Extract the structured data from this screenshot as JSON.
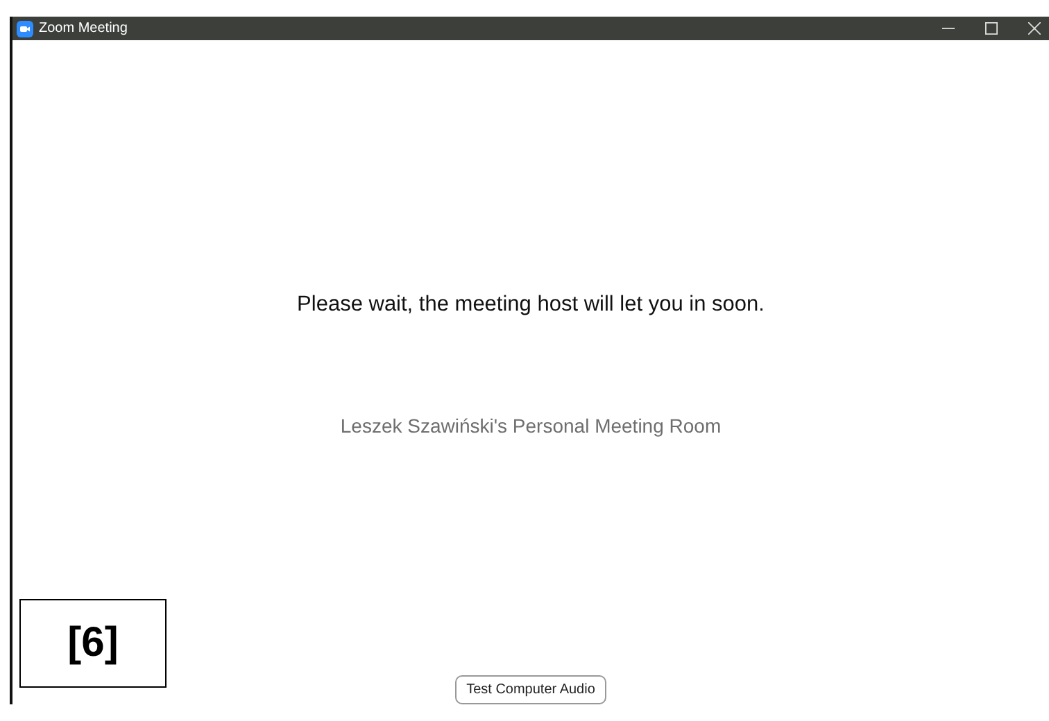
{
  "window": {
    "title": "Zoom Meeting"
  },
  "message": "Please wait, the meeting host will let you in soon.",
  "room_name": "Leszek Szawiński's Personal Meeting Room",
  "buttons": [
    {
      "label": "Test Computer Audio"
    }
  ],
  "figure_label": "[6]"
}
